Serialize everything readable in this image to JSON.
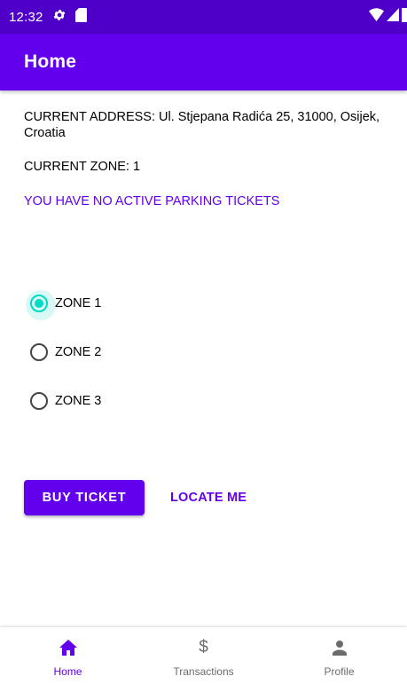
{
  "colors": {
    "status_bar": "#4f00c8",
    "primary": "#6200ee",
    "accent": "#03dac5",
    "inactive": "#6b6b6b"
  },
  "status_bar": {
    "time": "12:32",
    "icons": [
      "settings-icon",
      "sd-card-icon",
      "wifi-icon",
      "signal-icon",
      "battery-icon"
    ]
  },
  "app_bar": {
    "title": "Home"
  },
  "main": {
    "address": "CURRENT ADDRESS: Ul. Stjepana Radića 25, 31000, Osijek, Croatia",
    "zone": "CURRENT ZONE: 1",
    "tickets_status": "YOU HAVE NO ACTIVE PARKING TICKETS",
    "zones": [
      {
        "label": "ZONE 1",
        "checked": true
      },
      {
        "label": "ZONE 2",
        "checked": false
      },
      {
        "label": "ZONE 3",
        "checked": false
      }
    ],
    "buy_label": "BUY TICKET",
    "locate_label": "LOCATE ME"
  },
  "bottom_nav": {
    "items": [
      {
        "label": "Home",
        "icon": "home-icon",
        "active": true
      },
      {
        "label": "Transactions",
        "icon": "dollar-icon",
        "active": false
      },
      {
        "label": "Profile",
        "icon": "person-icon",
        "active": false
      }
    ]
  }
}
